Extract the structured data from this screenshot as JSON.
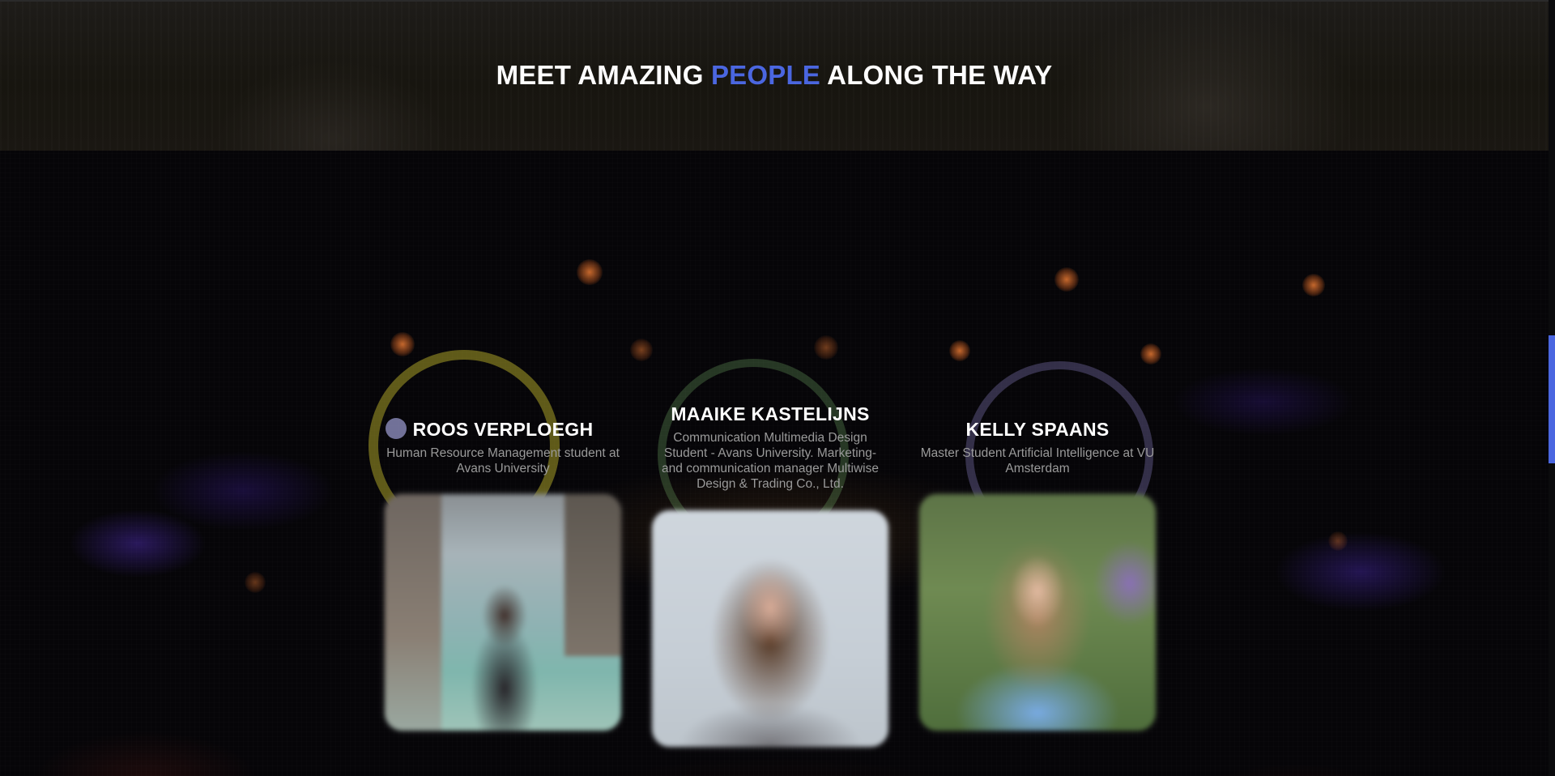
{
  "section": {
    "heading": {
      "part1": "MEET AMAZING ",
      "accent": "PEOPLE",
      "part2": " ALONG THE WAY"
    },
    "accent_color": "#4a66e0"
  },
  "speakers": [
    {
      "name": "ROOS VERPLOEGH",
      "role": "Human Resource Management student at Avans University",
      "photo": "portrait-photo"
    },
    {
      "name": "MAAIKE KASTELIJNS",
      "role": "Communication Multimedia Design Student - Avans University. Marketing- and communication manager Multiwise Design & Trading Co., Ltd.",
      "photo": "portrait-photo"
    },
    {
      "name": "KELLY SPAANS",
      "role": "Master Student Artificial Intelligence at VU Amsterdam",
      "photo": "portrait-photo"
    }
  ]
}
